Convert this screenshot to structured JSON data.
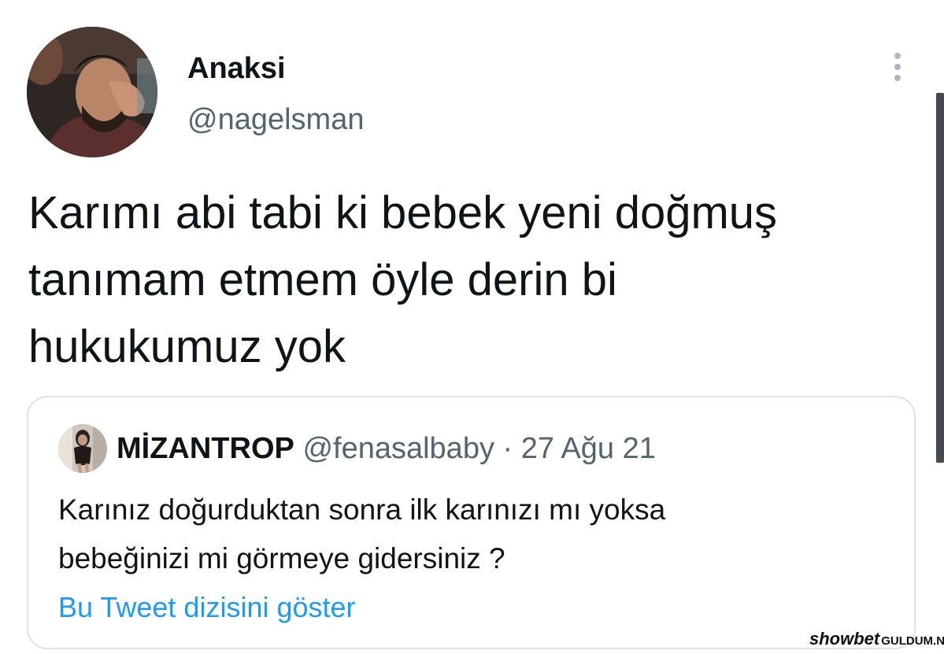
{
  "tweet": {
    "author": {
      "display_name": "Anaksi",
      "handle": "@nagelsman"
    },
    "text_lines": [
      "Karımı abi tabi ki bebek yeni doğmuş",
      "tanımam etmem öyle derin bi",
      "hukukumuz yok"
    ],
    "more_icon": "more-vertical-icon"
  },
  "quoted_tweet": {
    "display_name": "MİZANTROP",
    "meta": "@fenasalbaby · 27 Ağu 21",
    "text_lines": [
      "Karınız doğurduktan sonra ilk karınızı mı yoksa",
      "bebeğinizi mi görmeye gidersiniz ?"
    ],
    "show_thread_label": "Bu Tweet dizisini göster"
  },
  "watermark": {
    "brand": "showbet",
    "site": "GULDUM.NET"
  },
  "colors": {
    "text_primary": "#0f1419",
    "text_secondary": "#536471",
    "link": "#1d9bf0",
    "border": "#dfe4e8"
  }
}
